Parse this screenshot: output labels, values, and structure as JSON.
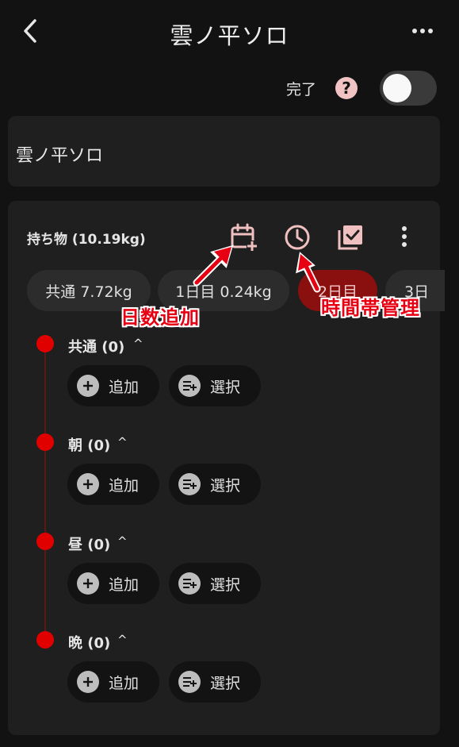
{
  "header": {
    "title": "雲ノ平ソロ"
  },
  "done": {
    "label": "完了",
    "help_symbol": "?",
    "toggle_on": false
  },
  "trip": {
    "name": "雲ノ平ソロ"
  },
  "items": {
    "title": "持ち物 (10.19kg)",
    "tools": [
      {
        "name": "calendar-add-icon"
      },
      {
        "name": "clock-icon"
      },
      {
        "name": "checklist-icon"
      },
      {
        "name": "more-vertical-icon"
      }
    ],
    "day_tabs": [
      {
        "label": "共通 7.72kg"
      },
      {
        "label": "1日目 0.24kg"
      },
      {
        "label": "2日目",
        "active": true
      },
      {
        "label": "3日"
      }
    ],
    "sections": [
      {
        "label": "共通 (0)",
        "chevron": "^"
      },
      {
        "label": "朝 (0)",
        "chevron": "^"
      },
      {
        "label": "昼 (0)",
        "chevron": "^"
      },
      {
        "label": "晩 (0)",
        "chevron": "^"
      }
    ],
    "add_label": "追加",
    "select_label": "選択"
  },
  "annotations": {
    "days_add": "日数追加",
    "time_manage": "時間帯管理"
  },
  "colors": {
    "accent": "#e00000",
    "active_tab": "#8a0f0f",
    "annotation": "#e60012"
  }
}
